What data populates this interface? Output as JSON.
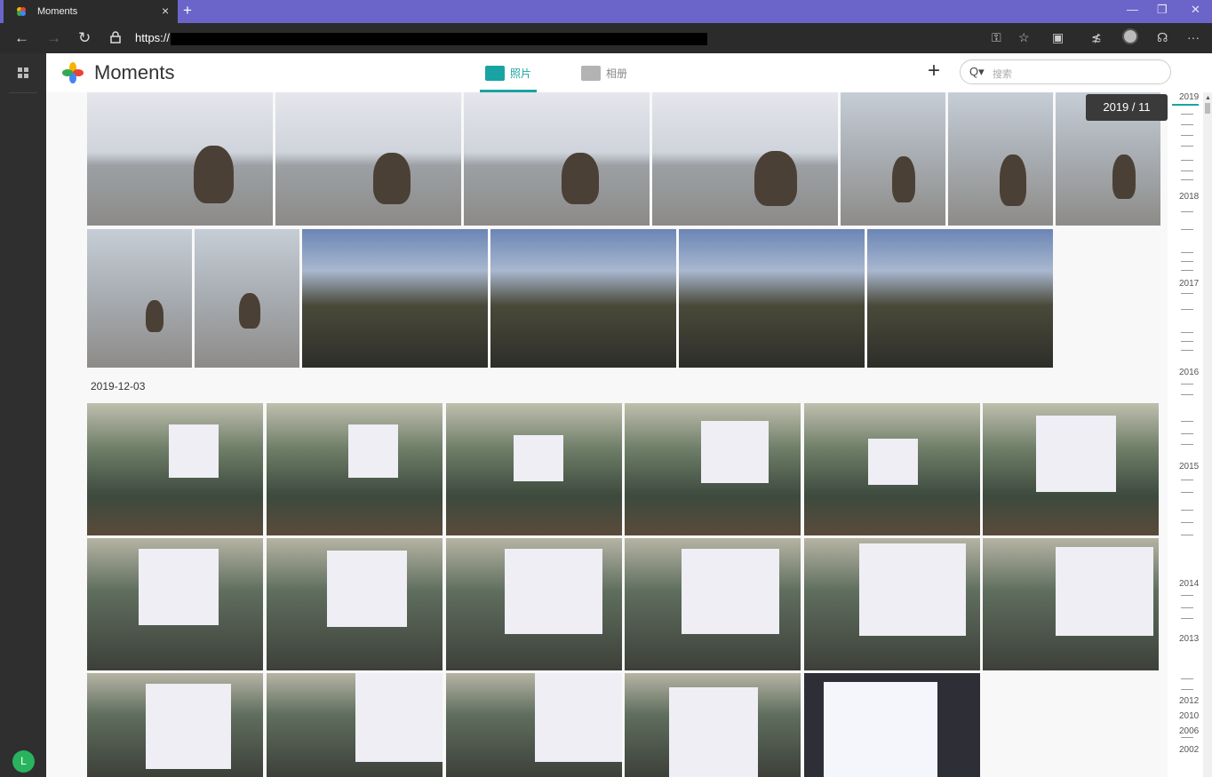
{
  "browser": {
    "tab_title": "Moments",
    "tab_close": "×",
    "new_tab": "+",
    "window_controls": {
      "minimize": "—",
      "restore": "❐",
      "close": "✕"
    },
    "nav": {
      "back": "←",
      "forward": "→",
      "refresh": "↻",
      "lock": "🔒"
    },
    "url": "https://",
    "toolbar_icons": [
      "key-icon",
      "star-icon",
      "extension-icon",
      "favorites-icon",
      "profile-icon",
      "read-aloud-icon",
      "more-icon"
    ],
    "more_label": "···"
  },
  "app": {
    "title": "Moments",
    "tabs": [
      {
        "label": "照片",
        "active": true
      },
      {
        "label": "相册",
        "active": false
      }
    ],
    "add_label": "+",
    "search": {
      "placeholder": "搜索",
      "icon": "Q▾"
    },
    "user_initial": "L",
    "accent": "#1aa3a3"
  },
  "gallery": {
    "section_date": "2019-12-03"
  },
  "timeline": {
    "tooltip": "2019 / 11",
    "years": [
      "2019",
      "2018",
      "2017",
      "2016",
      "2015",
      "2014",
      "2013",
      "2012",
      "2010",
      "2006",
      "2002"
    ]
  }
}
